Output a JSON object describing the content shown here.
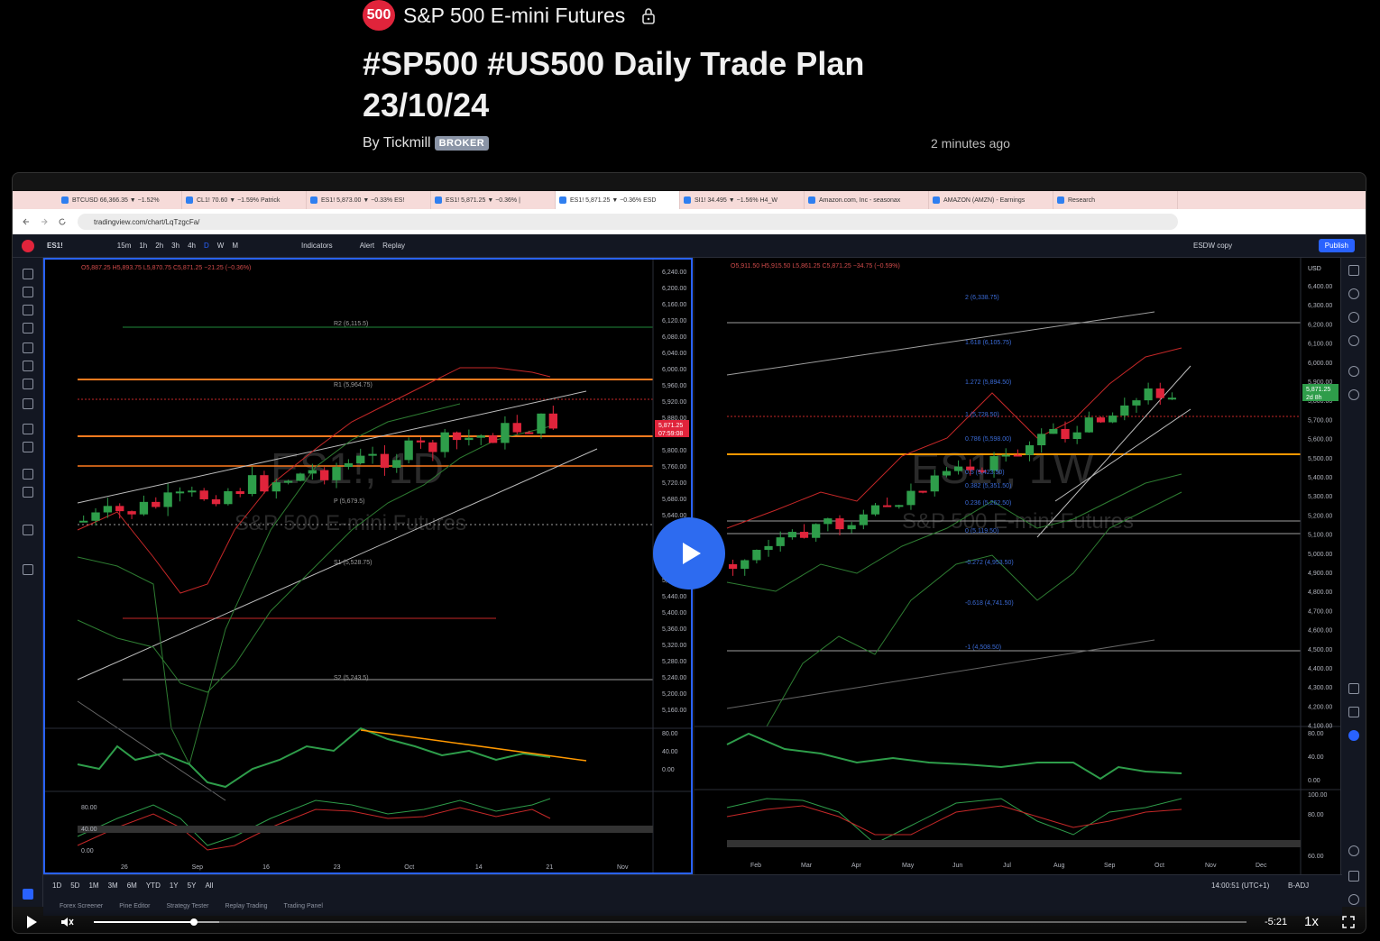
{
  "header": {
    "symbol_badge": "500",
    "symbol_name": "S&P 500 E-mini Futures",
    "lock_icon": "lock-icon",
    "title_line1": "#SP500 #US500 Daily Trade Plan",
    "title_line2": "23/10/24",
    "by_label": "By Tickmill",
    "broker_badge": "BROKER",
    "time_ago": "2 minutes ago"
  },
  "browser": {
    "tabs": [
      {
        "label": "BTCUSD 66,366.35 ▼ −1.52%"
      },
      {
        "label": "CL1! 70.60 ▼ −1.59% Patrick"
      },
      {
        "label": "ES1! 5,873.00 ▼ −0.33% ES!"
      },
      {
        "label": "ES1! 5,871.25 ▼ −0.36% |"
      },
      {
        "label": "ES1! 5,871.25 ▼ −0.36% ESD"
      },
      {
        "label": "SI1! 34.495 ▼ −1.56% H4_W"
      },
      {
        "label": "Amazon.com, Inc - seasonax"
      },
      {
        "label": "AMAZON (AMZN) - Earnings"
      },
      {
        "label": "Research"
      }
    ],
    "url": "tradingview.com/chart/LqTzgcFa/"
  },
  "toolbar": {
    "symbol": "ES1!",
    "intervals": [
      "15m",
      "1h",
      "2h",
      "3h",
      "4h",
      "D",
      "W",
      "M"
    ],
    "indicators_label": "Indicators",
    "alert_label": "Alert",
    "replay_label": "Replay",
    "layout_name": "ESDW copy",
    "publish_label": "Publish"
  },
  "left_chart": {
    "ohlc": "O5,887.25 H5,893.75 L5,870.75 C5,871.25 −21.25 (−0.36%)",
    "price_ticks": [
      "6,240.00",
      "6,200.00",
      "6,160.00",
      "6,120.00",
      "6,080.00",
      "6,040.00",
      "6,000.00",
      "5,960.00",
      "5,920.00",
      "5,880.00",
      "5,840.00",
      "5,800.00",
      "5,760.00",
      "5,720.00",
      "5,680.00",
      "5,640.00",
      "5,600.00",
      "5,560.00",
      "5,520.00",
      "5,480.00",
      "5,440.00",
      "5,400.00",
      "5,360.00",
      "5,320.00",
      "5,280.00",
      "5,240.00",
      "5,200.00",
      "5,160.00"
    ],
    "levels": [
      "R2 (6,115.5)",
      "R1 (5,964.75)",
      "P (5,679.5)",
      "S1 (5,528.75)",
      "S2 (5,243.5)"
    ],
    "last_price": "5,871.25",
    "countdown": "07:59:08",
    "time_labels": [
      "26",
      "Sep",
      "16",
      "23",
      "Oct",
      "14",
      "21",
      "Nov"
    ],
    "osc_ticks": [
      "80.00",
      "40.00",
      "0.00"
    ],
    "stoch_ticks": [
      "80.00",
      "40.00",
      "0.00"
    ],
    "watermark": "ES1!, 1D",
    "watermark_sub": "S&P 500 E-mini Futures"
  },
  "right_chart": {
    "ohlc": "O5,911.50 H5,915.50 L5,861.25 C5,871.25 −34.75 (−0.59%)",
    "currency": "USD",
    "price_ticks": [
      "6,400.00",
      "6,300.00",
      "6,200.00",
      "6,100.00",
      "6,000.00",
      "5,900.00",
      "5,800.00",
      "5,700.00",
      "5,600.00",
      "5,500.00",
      "5,400.00",
      "5,300.00",
      "5,200.00",
      "5,100.00",
      "5,000.00",
      "4,900.00",
      "4,800.00",
      "4,700.00",
      "4,600.00",
      "4,500.00",
      "4,400.00",
      "4,300.00",
      "4,200.00",
      "4,100.00"
    ],
    "fib_levels": [
      "2 (6,338.75)",
      "1.618 (6,105.75)",
      "1.272 (5,894.50)",
      "1 (5,728.50)",
      "0.786 (5,598.00)",
      "0.5 (5,423.50)",
      "0.382 (5,351.50)",
      "0.236 (5,262.50)",
      "0 (5,119.50)",
      "-0.272 (4,953.50)",
      "-0.618 (4,741.50)",
      "-1 (4,508.50)"
    ],
    "last_price": "5,871.25",
    "countdown": "2d 8h",
    "time_labels": [
      "Feb",
      "Mar",
      "Apr",
      "May",
      "Jun",
      "Jul",
      "Aug",
      "Sep",
      "Oct",
      "Nov",
      "Dec"
    ],
    "osc_ticks": [
      "80.00",
      "40.00",
      "0.00"
    ],
    "stoch_ticks": [
      "100.00",
      "80.00",
      "60.00"
    ],
    "watermark": "ES1!, 1W",
    "watermark_sub": "S&P 500 E-mini Futures"
  },
  "bottom_bar": {
    "ranges": [
      "1D",
      "5D",
      "1M",
      "3M",
      "6M",
      "YTD",
      "1Y",
      "5Y",
      "All"
    ],
    "clock": "14:00:51 (UTC+1)",
    "adj": "B-ADJ"
  },
  "footer_tabs": [
    "Forex Screener",
    "Pine Editor",
    "Strategy Tester",
    "Replay Trading",
    "Trading Panel"
  ],
  "player": {
    "progress": 0.087,
    "buffered": 0.109,
    "time_left": "-5:21",
    "speed": "1x",
    "accent": "#2d6bf0"
  }
}
